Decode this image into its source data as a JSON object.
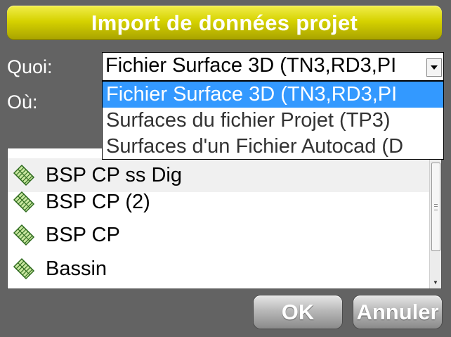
{
  "title": "Import de données projet",
  "fields": {
    "what_label": "Quoi:",
    "where_label": "Où:",
    "selected_type": "Fichier Surface 3D (TN3,RD3,PI"
  },
  "dropdown": {
    "options": [
      "Fichier Surface 3D (TN3,RD3,PI",
      "Surfaces du fichier Projet (TP3)",
      "Surfaces d'un Fichier Autocad (D"
    ]
  },
  "surfaces": [
    "BSP CP ss Dig",
    "BSP CP (2)",
    "BSP CP",
    "Bassin"
  ],
  "buttons": {
    "ok": "OK",
    "cancel": "Annuler"
  },
  "icons": {
    "select_arrow": "chevron-down-icon",
    "surface_item": "surface-mesh-icon"
  },
  "colors": {
    "title_bar": "#d6d200",
    "selection": "#3399ff",
    "background": "#636363"
  }
}
